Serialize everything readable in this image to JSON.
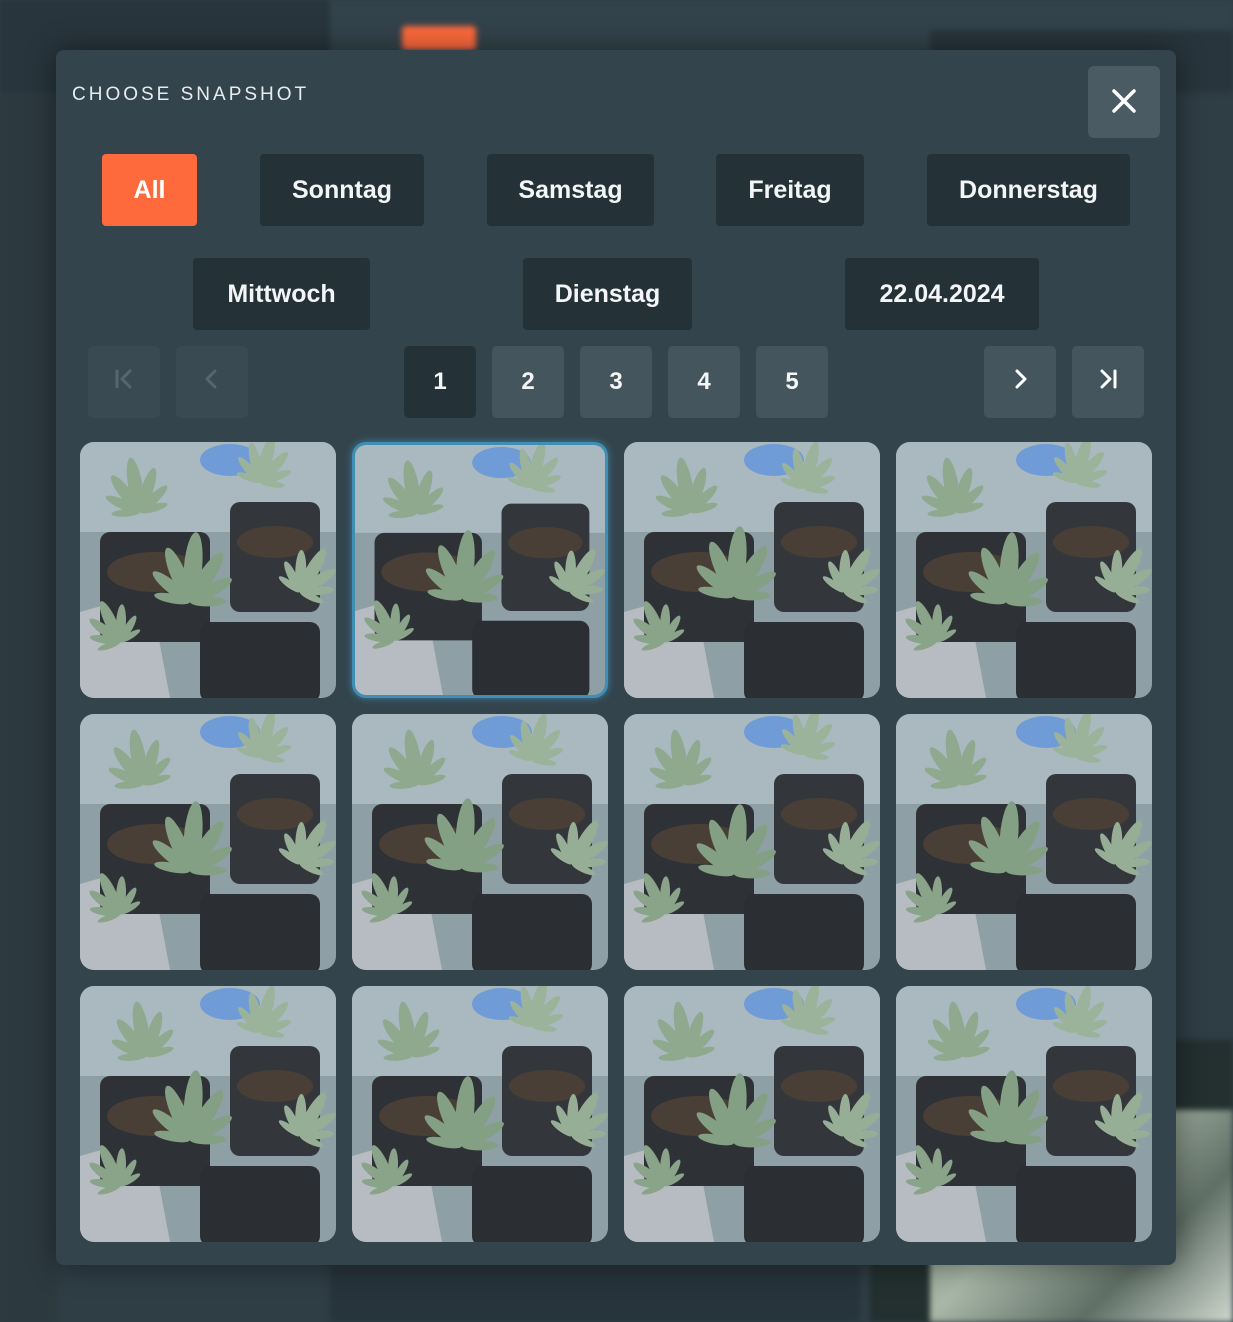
{
  "modal": {
    "title": "CHOOSE SNAPSHOT",
    "close_icon": "close-icon"
  },
  "filters": [
    {
      "label": "All",
      "active": true
    },
    {
      "label": "Sonntag",
      "active": false
    },
    {
      "label": "Samstag",
      "active": false
    },
    {
      "label": "Freitag",
      "active": false
    },
    {
      "label": "Donnerstag",
      "active": false
    },
    {
      "label": "Mittwoch",
      "active": false
    },
    {
      "label": "Dienstag",
      "active": false
    },
    {
      "label": "22.04.2024",
      "active": false
    }
  ],
  "pagination": {
    "first_icon": "first-page-icon",
    "prev_icon": "previous-page-icon",
    "next_icon": "next-page-icon",
    "last_icon": "last-page-icon",
    "pages": [
      "1",
      "2",
      "3",
      "4",
      "5"
    ],
    "current_page": "1"
  },
  "snapshots": {
    "count": 12,
    "selected_index": 1,
    "image_subject": "plant-photo"
  },
  "colors": {
    "accent": "#ff6a3d",
    "selected_border": "#3f8fb5",
    "modal_bg": "#34444c",
    "button_bg": "#243238"
  }
}
